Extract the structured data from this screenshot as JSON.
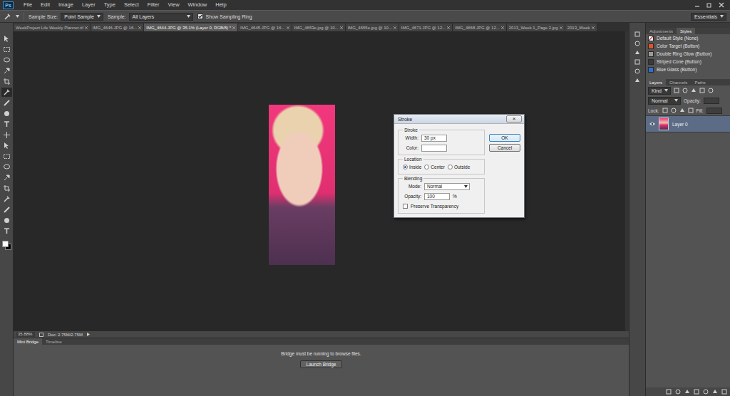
{
  "app": {
    "logo": "Ps",
    "menus": [
      "File",
      "Edit",
      "Image",
      "Layer",
      "Type",
      "Select",
      "Filter",
      "View",
      "Window",
      "Help"
    ]
  },
  "options_bar": {
    "sample_size_label": "Sample Size:",
    "sample_size": "Point Sample",
    "sample_label": "Sample:",
    "sample": "All Layers",
    "show_sampling_ring": {
      "label": "Show Sampling Ring",
      "checked": true
    },
    "workspace": "Essentials"
  },
  "document_tabs": [
    {
      "label": "WeekProject Life Weekly Planner.tif",
      "selected": false
    },
    {
      "label": "IMG_4646.JPG @ 16...",
      "selected": false
    },
    {
      "label": "IMG_4644.JPG @ 35.1% (Layer 0, RGB/8) *",
      "selected": true
    },
    {
      "label": "IMG_4645.JPG @ 16...",
      "selected": false
    },
    {
      "label": "IMG_4653e.jpg @ 10...",
      "selected": false
    },
    {
      "label": "IMG_4655e.jpg @ 10...",
      "selected": false
    },
    {
      "label": "IMG_4671.JPG @ 12...",
      "selected": false
    },
    {
      "label": "IMG_4668.JPG @ 12...",
      "selected": false
    },
    {
      "label": "2013_Week 1_Page 2.jpg",
      "selected": false
    },
    {
      "label": "2013_Week",
      "selected": false
    }
  ],
  "tools": [
    {
      "selected": false
    },
    {
      "selected": false
    },
    {
      "selected": false
    },
    {
      "selected": false
    },
    {
      "selected": false
    },
    {
      "selected": true
    },
    {
      "selected": false
    },
    {
      "selected": false
    },
    {
      "selected": false
    },
    {
      "selected": false
    },
    {
      "selected": false
    },
    {
      "selected": false
    },
    {
      "selected": false
    },
    {
      "selected": false
    },
    {
      "selected": false
    },
    {
      "selected": false
    },
    {
      "selected": false
    },
    {
      "selected": false
    },
    {
      "selected": false
    }
  ],
  "colors": {
    "foreground": "#ffffff",
    "background": "#000000"
  },
  "status_bar": {
    "zoom": "35.88%",
    "doc_info": "Doc: 2.75M/2.75M"
  },
  "bottom_panel": {
    "tabs": [
      {
        "label": "Mini Bridge",
        "selected": true
      },
      {
        "label": "Timeline",
        "selected": false
      }
    ],
    "message": "Bridge must be running to browse files.",
    "button": "Launch Bridge"
  },
  "styles_panel": {
    "tabs": [
      {
        "label": "Adjustments",
        "selected": false
      },
      {
        "label": "Styles",
        "selected": true
      }
    ],
    "items": [
      {
        "label": "Default Style (None)",
        "kind": "none",
        "color": "#ffffff"
      },
      {
        "label": "Color Target (Button)",
        "kind": "swatch",
        "color": "#d9572b"
      },
      {
        "label": "Double Ring Glow (Button)",
        "kind": "swatch",
        "color": "#9a9a9a"
      },
      {
        "label": "Striped Cone (Button)",
        "kind": "swatch",
        "color": "#3a3a3a"
      },
      {
        "label": "Blue Glass (Button)",
        "kind": "swatch",
        "color": "#2f6fd0"
      }
    ]
  },
  "layers_panel": {
    "tabs": [
      {
        "label": "Layers",
        "selected": true
      },
      {
        "label": "Channels",
        "selected": false
      },
      {
        "label": "Paths",
        "selected": false
      }
    ],
    "filter": "Kind",
    "blend_mode": "Normal",
    "opacity_label": "Opacity:",
    "lock_label": "Lock:",
    "fill_label": "Fill:",
    "layers": [
      {
        "name": "Layer 0",
        "visible": true,
        "selected": true
      }
    ]
  },
  "dialog": {
    "title": "Stroke",
    "close": "×",
    "stroke_group": "Stroke",
    "width_label": "Width:",
    "width": "30 px",
    "color_label": "Color:",
    "color": "#ffffff",
    "location_group": "Location",
    "locations": [
      {
        "label": "Inside",
        "selected": true
      },
      {
        "label": "Center",
        "selected": false
      },
      {
        "label": "Outside",
        "selected": false
      }
    ],
    "blending_group": "Blending",
    "mode_label": "Mode:",
    "mode": "Normal",
    "opacity_label": "Opacity:",
    "opacity": "100",
    "opacity_unit": "%",
    "preserve_transparency": {
      "label": "Preserve Transparency",
      "checked": false
    },
    "buttons": [
      {
        "label": "OK",
        "default": true
      },
      {
        "label": "Cancel",
        "default": false
      }
    ]
  }
}
